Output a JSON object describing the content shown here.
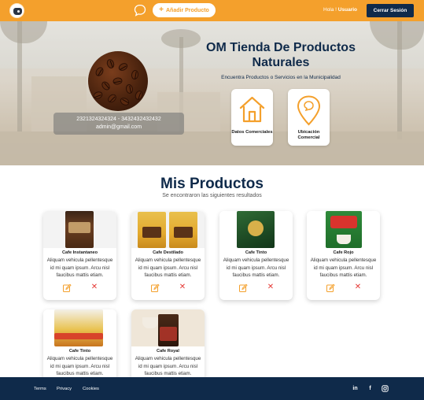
{
  "nav": {
    "add_product_label": "Añadir Producto",
    "greeting": "Hola !",
    "username": "Usuario",
    "logout_label": "Cerrar Sesión"
  },
  "hero": {
    "phones": "2321324324324 - 3432432432432",
    "email": "admin@gmail.com",
    "shop_title": "OM Tienda De Productos Naturales",
    "shop_subtitle": "Encuentra Productos o Servicios en la Municipalidad",
    "cards": [
      {
        "label": "Datos Comerciales",
        "icon": "house-icon"
      },
      {
        "label": "Ubicación Comercial",
        "icon": "location-pin-icon"
      }
    ]
  },
  "products_section": {
    "title": "Mis Productos",
    "subtitle": "Se encontraron las siguientes resultados"
  },
  "products": [
    {
      "name": "Cafe Instantaneo",
      "description": "Aliquam vehicula pellentesque id mi quam ipsum. Arcu nisl faucibus mattis etiam."
    },
    {
      "name": "Cafe Destilado",
      "description": "Aliquam vehicula pellentesque id mi quam ipsum. Arcu nisl faucibus mattis etiam."
    },
    {
      "name": "Cafe Tinto",
      "description": "Aliquam vehicula pellentesque id mi quam ipsum. Arcu nisl faucibus mattis etiam."
    },
    {
      "name": "Cafe Rojo",
      "description": "Aliquam vehicula pellentesque id mi quam ipsum. Arcu nisl faucibus mattis etiam."
    },
    {
      "name": "Cafe Tinto",
      "description": "Aliquam vehicula pellentesque id mi quam ipsum. Arcu nisl faucibus mattis etiam."
    },
    {
      "name": "Cafe Royal",
      "description": "Aliquam vehicula pellentesque id mi quam ipsum. Arcu nisl faucibus mattis etiam."
    }
  ],
  "footer": {
    "links": [
      "Terms",
      "Privacy",
      "Cookies"
    ],
    "social": [
      "linkedin-icon",
      "facebook-icon",
      "instagram-icon"
    ]
  },
  "colors": {
    "brand_orange": "#f4a02c",
    "navy": "#0f2a4a",
    "delete_red": "#e53935"
  }
}
